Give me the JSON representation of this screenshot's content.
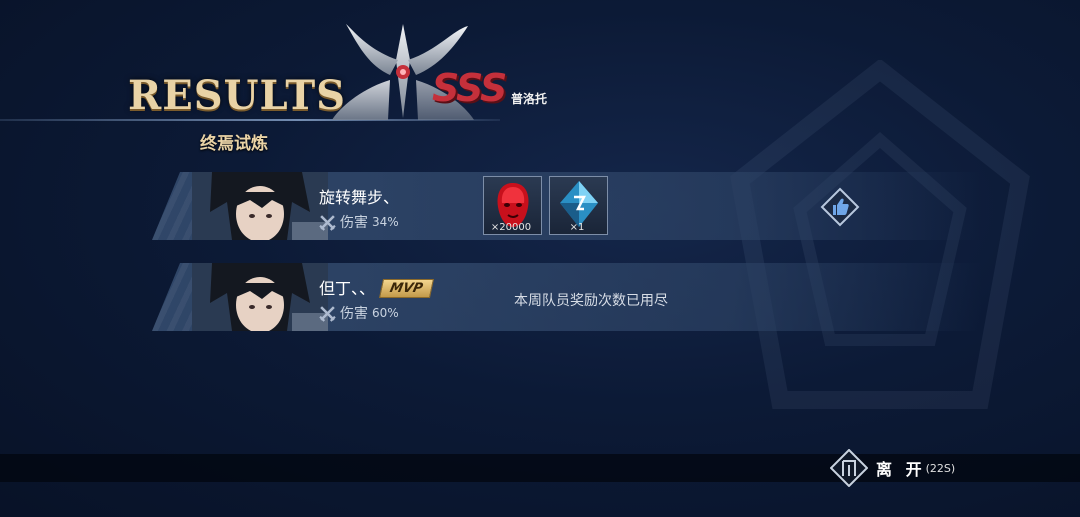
{
  "header": {
    "title": "RESULTS",
    "subtitle": "终焉试炼",
    "rank": "SSS",
    "boss_name": "普洛托"
  },
  "players": [
    {
      "name": "旋转舞步、",
      "damage_label": "伤害",
      "damage_value": "34%",
      "mvp": false,
      "rewards": [
        {
          "icon": "red-mask-item",
          "qty": "×20000"
        },
        {
          "icon": "blue-crystal-item",
          "qty": "×1"
        }
      ]
    },
    {
      "name": "但丁、、",
      "damage_label": "伤害",
      "damage_value": "60%",
      "mvp": true,
      "mvp_label": "MVP",
      "notice": "本周队员奖励次数已用尽"
    }
  ],
  "footer": {
    "leave_label": "离 开",
    "timer": "(22S)"
  },
  "colors": {
    "gold": "#e9d3a6",
    "rank_red": "#c5303b",
    "row_bg": "#3c567a"
  }
}
